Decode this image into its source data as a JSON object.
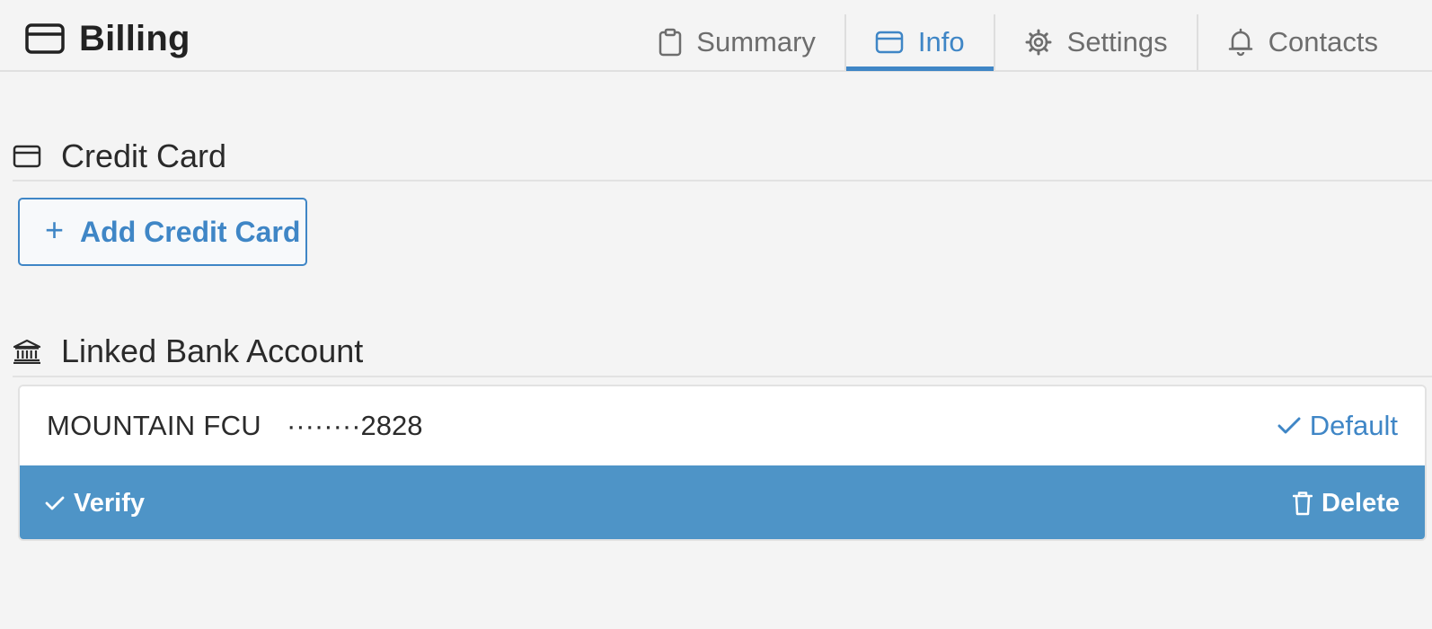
{
  "header": {
    "title": "Billing",
    "title_icon": "credit-card-icon",
    "tabs": [
      {
        "label": "Summary",
        "icon": "clipboard-icon",
        "active": false
      },
      {
        "label": "Info",
        "icon": "credit-card-icon",
        "active": true
      },
      {
        "label": "Settings",
        "icon": "gear-icon",
        "active": false
      },
      {
        "label": "Contacts",
        "icon": "bell-icon",
        "active": false
      }
    ]
  },
  "credit_card": {
    "heading": "Credit Card",
    "icon": "credit-card-icon",
    "add_button": {
      "symbol": "+",
      "label": "Add Credit Card"
    }
  },
  "bank": {
    "heading": "Linked Bank Account",
    "icon": "bank-icon",
    "account": {
      "name": "MOUNTAIN FCU",
      "masked_number": "········2828",
      "default_label": "Default"
    },
    "actions": {
      "verify_label": "Verify",
      "delete_label": "Delete"
    }
  },
  "colors": {
    "accent": "#3f86c6",
    "action_bar": "#4e94c7",
    "background": "#f4f4f4"
  }
}
